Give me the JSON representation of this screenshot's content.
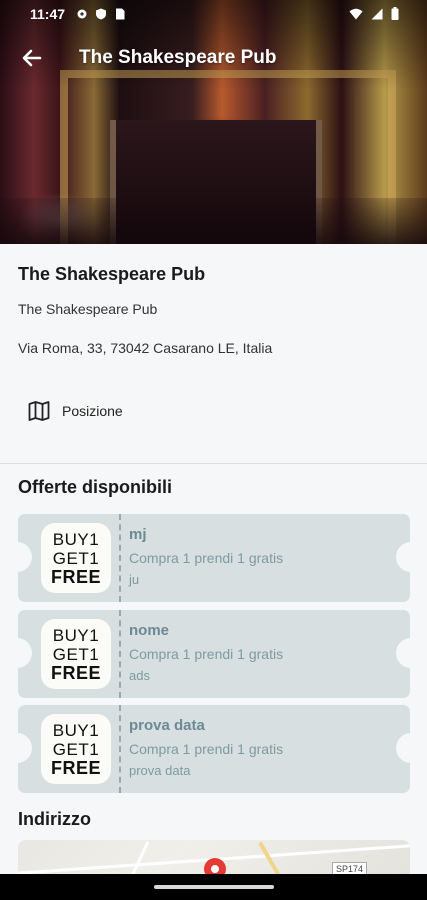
{
  "status_bar": {
    "time": "11:47",
    "left_icons": [
      "gear-icon",
      "shield-icon",
      "sim-card-icon"
    ],
    "right_icons": [
      "wifi-icon",
      "signal-icon",
      "battery-icon"
    ]
  },
  "app_bar": {
    "back_icon": "arrow-left-icon",
    "title": "The Shakespeare Pub"
  },
  "venue": {
    "name": "The Shakespeare Pub",
    "subtitle": "The Shakespeare Pub",
    "address": "Via Roma, 33, 73042 Casarano LE, Italia",
    "position_button": {
      "icon": "map-icon",
      "label": "Posizione"
    }
  },
  "offers": {
    "title": "Offerte disponibili",
    "items": [
      {
        "badge": [
          "BUY1",
          "GET1",
          "FREE"
        ],
        "title": "mj",
        "description": "Compra 1 prendi 1 gratis",
        "note": "ju"
      },
      {
        "badge": [
          "BUY1",
          "GET1",
          "FREE"
        ],
        "title": "nome",
        "description": "Compra 1 prendi 1 gratis",
        "note": "ads"
      },
      {
        "badge": [
          "BUY1",
          "GET1",
          "FREE"
        ],
        "title": "prova data",
        "description": "Compra 1 prendi 1 gratis",
        "note": "prova data"
      }
    ]
  },
  "address_section": {
    "title": "Indirizzo",
    "map_road_label": "SP174"
  },
  "colors": {
    "coupon_bg": "#d8dfe1",
    "coupon_text": "#7d9aa2",
    "pin": "#e53935"
  }
}
